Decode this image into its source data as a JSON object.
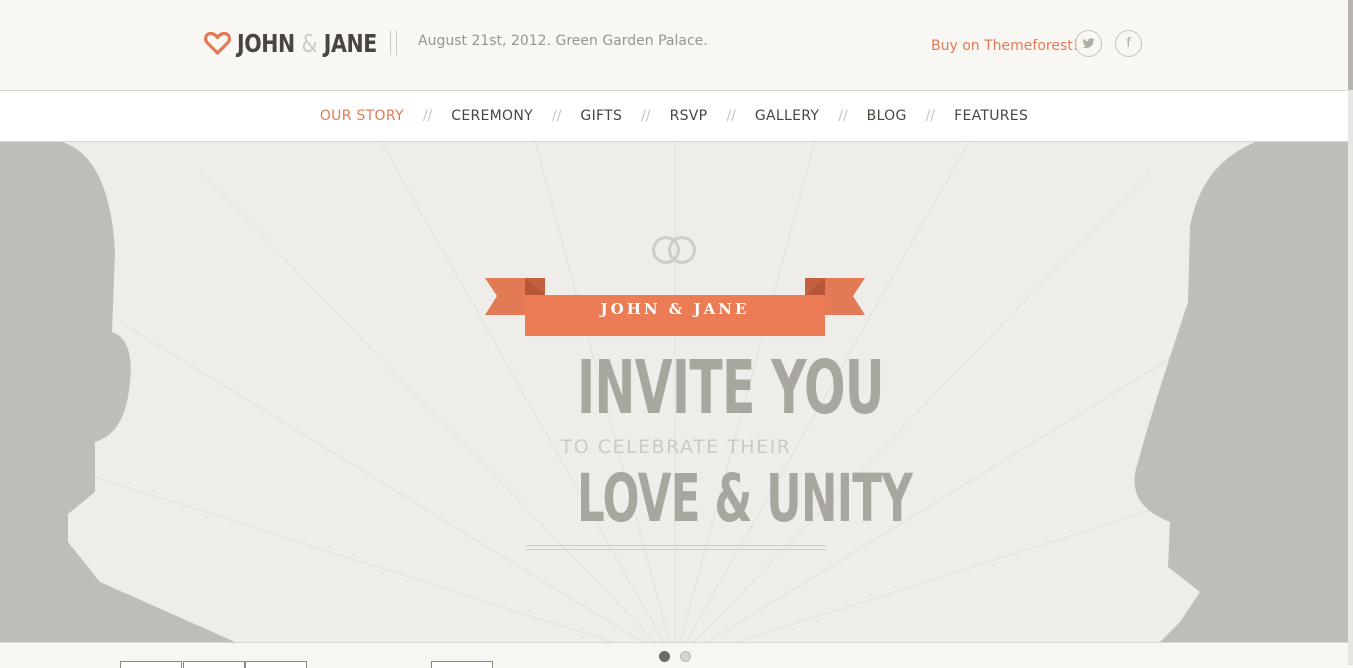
{
  "header": {
    "logo_text_1": "JOHN",
    "logo_amp": "&",
    "logo_text_2": "JANE",
    "tagline": "August 21st, 2012. Green Garden Palace.",
    "buy_link": "Buy on Themeforest!",
    "social": [
      {
        "name": "twitter",
        "icon": "twitter-icon"
      },
      {
        "name": "facebook",
        "icon": "facebook-icon",
        "glyph": "f"
      }
    ]
  },
  "nav": {
    "separator": "//",
    "items": [
      {
        "label": "OUR STORY",
        "active": true
      },
      {
        "label": "CEREMONY",
        "active": false
      },
      {
        "label": "GIFTS",
        "active": false
      },
      {
        "label": "RSVP",
        "active": false
      },
      {
        "label": "GALLERY",
        "active": false
      },
      {
        "label": "BLOG",
        "active": false
      },
      {
        "label": "FEATURES",
        "active": false
      }
    ]
  },
  "hero": {
    "banner_text": "JOHN & JANE",
    "headline_1": "INVITE YOU",
    "subline": "TO CELEBRATE THEIR",
    "headline_2": "LOVE & UNITY"
  },
  "slider": {
    "slide_count": 2,
    "active_slide": 1
  },
  "colors": {
    "accent": "#e27a55",
    "text_dark": "#4a4540",
    "hero_bg": "#eeede9",
    "silhouette": "#bfbdb9"
  }
}
